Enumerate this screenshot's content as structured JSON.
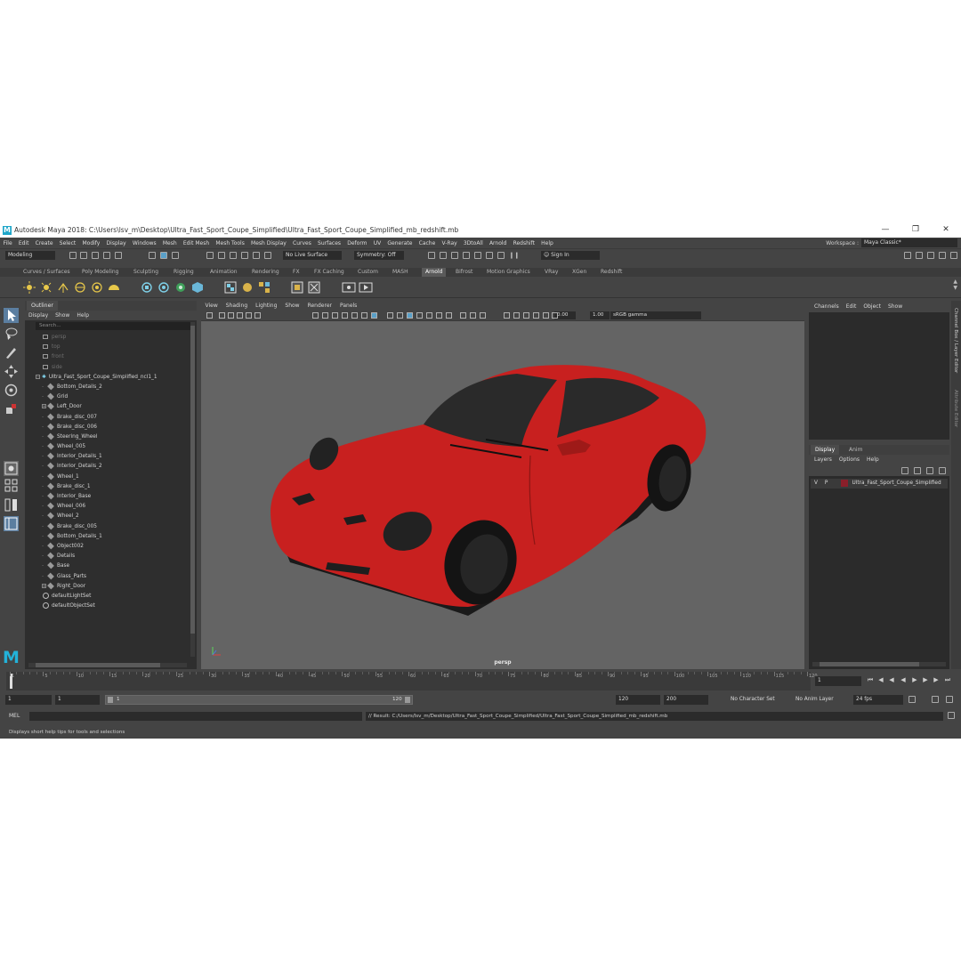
{
  "window": {
    "title": "Autodesk Maya 2018: C:\\Users\\lsv_m\\Desktop\\Ultra_Fast_Sport_Coupe_Simplified\\Ultra_Fast_Sport_Coupe_Simplified_mb_redshift.mb",
    "logo_letter": "M"
  },
  "menubar": {
    "items": [
      "File",
      "Edit",
      "Create",
      "Select",
      "Modify",
      "Display",
      "Windows",
      "Mesh",
      "Edit Mesh",
      "Mesh Tools",
      "Mesh Display",
      "Curves",
      "Surfaces",
      "Deform",
      "UV",
      "Generate",
      "Cache",
      "V-Ray",
      "3DtoAll",
      "Arnold",
      "Redshift",
      "Help"
    ],
    "workspace_label": "Workspace :",
    "workspace_value": "Maya Classic*"
  },
  "statusline": {
    "mode": "Modeling",
    "live_surface": "No Live Surface",
    "symmetry": "Symmetry: Off",
    "sign_in": "Sign In"
  },
  "shelf_tabs": [
    "Curves / Surfaces",
    "Poly Modeling",
    "Sculpting",
    "Rigging",
    "Animation",
    "Rendering",
    "FX",
    "FX Caching",
    "Custom",
    "MASH",
    "Arnold",
    "Bifrost",
    "Motion Graphics",
    "VRay",
    "XGen",
    "Redshift"
  ],
  "outliner": {
    "tab": "Outliner",
    "menu": [
      "Display",
      "Show",
      "Help"
    ],
    "search_placeholder": "Search...",
    "cameras": [
      "persp",
      "top",
      "front",
      "side"
    ],
    "root": "Ultra_Fast_Sport_Coupe_Simplified_ncl1_1",
    "children": [
      {
        "name": "Bottom_Details_2",
        "expandable": false
      },
      {
        "name": "Grid",
        "expandable": false
      },
      {
        "name": "Left_Door",
        "expandable": true
      },
      {
        "name": "Brake_disc_007",
        "expandable": false
      },
      {
        "name": "Brake_disc_006",
        "expandable": false
      },
      {
        "name": "Steering_Wheel",
        "expandable": false
      },
      {
        "name": "Wheel_005",
        "expandable": false
      },
      {
        "name": "Interior_Details_1",
        "expandable": false
      },
      {
        "name": "Interior_Details_2",
        "expandable": false
      },
      {
        "name": "Wheel_1",
        "expandable": false
      },
      {
        "name": "Brake_disc_1",
        "expandable": false
      },
      {
        "name": "Interior_Base",
        "expandable": false
      },
      {
        "name": "Wheel_006",
        "expandable": false
      },
      {
        "name": "Wheel_2",
        "expandable": false
      },
      {
        "name": "Brake_disc_005",
        "expandable": false
      },
      {
        "name": "Bottom_Details_1",
        "expandable": false
      },
      {
        "name": "Object002",
        "expandable": false
      },
      {
        "name": "Details",
        "expandable": false
      },
      {
        "name": "Base",
        "expandable": false
      },
      {
        "name": "Glass_Parts",
        "expandable": false
      },
      {
        "name": "Right_Door",
        "expandable": true
      }
    ],
    "sets": [
      "defaultLightSet",
      "defaultObjectSet"
    ]
  },
  "viewport": {
    "menu": [
      "View",
      "Shading",
      "Lighting",
      "Show",
      "Renderer",
      "Panels"
    ],
    "exposure": "0.00",
    "gamma": "1.00",
    "color_space": "sRGB gamma",
    "camera_label": "persp",
    "car_color": "#c8201f"
  },
  "channel_box": {
    "menu": [
      "Channels",
      "Edit",
      "Object",
      "Show"
    ],
    "side_tabs": [
      "Channel Box / Layer Editor",
      "Attribute Editor"
    ]
  },
  "layer_editor": {
    "tabs": [
      "Display",
      "Anim"
    ],
    "menu": [
      "Layers",
      "Options",
      "Help"
    ],
    "layer": {
      "v": "V",
      "p": "P",
      "name": "Ultra_Fast_Sport_Coupe_Simplified",
      "color": "#8a1f2a"
    }
  },
  "time_slider": {
    "ticks": [
      "1",
      "5",
      "10",
      "15",
      "20",
      "25",
      "30",
      "35",
      "40",
      "45",
      "50",
      "55",
      "60",
      "65",
      "70",
      "75",
      "80",
      "85",
      "90",
      "95",
      "100",
      "105",
      "110",
      "115",
      "120"
    ],
    "current_frame": "1"
  },
  "range_slider": {
    "start": "1",
    "anim_start": "1",
    "range_start_label": "1",
    "range_end_label": "120",
    "end": "120",
    "anim_end": "200",
    "character_set": "No Character Set",
    "anim_layer": "No Anim Layer",
    "fps": "24 fps"
  },
  "command_line": {
    "label": "MEL",
    "result": "// Result: C:/Users/lsv_m/Desktop/Ultra_Fast_Sport_Coupe_Simplified/Ultra_Fast_Sport_Coupe_Simplified_mb_redshift.mb"
  },
  "help_line": "Displays short help tips for tools and selections"
}
